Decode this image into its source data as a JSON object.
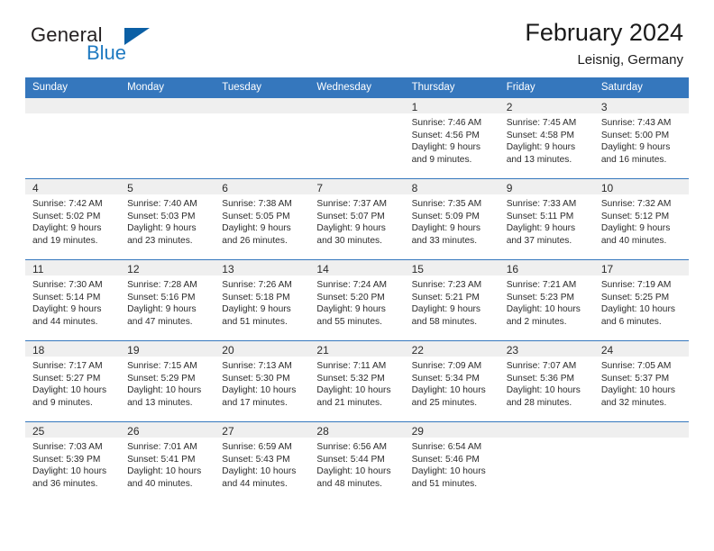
{
  "brand": {
    "name_part1": "General",
    "name_part2": "Blue",
    "triangle_icon": "triangle-icon"
  },
  "header": {
    "title": "February 2024",
    "location": "Leisnig, Germany"
  },
  "calendar": {
    "weekday_headers": [
      "Sunday",
      "Monday",
      "Tuesday",
      "Wednesday",
      "Thursday",
      "Friday",
      "Saturday"
    ],
    "accent_color": "#3577bd",
    "daynum_bg": "#efefef",
    "labels": {
      "sunrise": "Sunrise:",
      "sunset": "Sunset:",
      "daylight": "Daylight:"
    },
    "weeks": [
      [
        {
          "day": "",
          "empty": true
        },
        {
          "day": "",
          "empty": true
        },
        {
          "day": "",
          "empty": true
        },
        {
          "day": "",
          "empty": true
        },
        {
          "day": "1",
          "sunrise": "Sunrise: 7:46 AM",
          "sunset": "Sunset: 4:56 PM",
          "daylight_line1": "Daylight: 9 hours",
          "daylight_line2": "and 9 minutes."
        },
        {
          "day": "2",
          "sunrise": "Sunrise: 7:45 AM",
          "sunset": "Sunset: 4:58 PM",
          "daylight_line1": "Daylight: 9 hours",
          "daylight_line2": "and 13 minutes."
        },
        {
          "day": "3",
          "sunrise": "Sunrise: 7:43 AM",
          "sunset": "Sunset: 5:00 PM",
          "daylight_line1": "Daylight: 9 hours",
          "daylight_line2": "and 16 minutes."
        }
      ],
      [
        {
          "day": "4",
          "sunrise": "Sunrise: 7:42 AM",
          "sunset": "Sunset: 5:02 PM",
          "daylight_line1": "Daylight: 9 hours",
          "daylight_line2": "and 19 minutes."
        },
        {
          "day": "5",
          "sunrise": "Sunrise: 7:40 AM",
          "sunset": "Sunset: 5:03 PM",
          "daylight_line1": "Daylight: 9 hours",
          "daylight_line2": "and 23 minutes."
        },
        {
          "day": "6",
          "sunrise": "Sunrise: 7:38 AM",
          "sunset": "Sunset: 5:05 PM",
          "daylight_line1": "Daylight: 9 hours",
          "daylight_line2": "and 26 minutes."
        },
        {
          "day": "7",
          "sunrise": "Sunrise: 7:37 AM",
          "sunset": "Sunset: 5:07 PM",
          "daylight_line1": "Daylight: 9 hours",
          "daylight_line2": "and 30 minutes."
        },
        {
          "day": "8",
          "sunrise": "Sunrise: 7:35 AM",
          "sunset": "Sunset: 5:09 PM",
          "daylight_line1": "Daylight: 9 hours",
          "daylight_line2": "and 33 minutes."
        },
        {
          "day": "9",
          "sunrise": "Sunrise: 7:33 AM",
          "sunset": "Sunset: 5:11 PM",
          "daylight_line1": "Daylight: 9 hours",
          "daylight_line2": "and 37 minutes."
        },
        {
          "day": "10",
          "sunrise": "Sunrise: 7:32 AM",
          "sunset": "Sunset: 5:12 PM",
          "daylight_line1": "Daylight: 9 hours",
          "daylight_line2": "and 40 minutes."
        }
      ],
      [
        {
          "day": "11",
          "sunrise": "Sunrise: 7:30 AM",
          "sunset": "Sunset: 5:14 PM",
          "daylight_line1": "Daylight: 9 hours",
          "daylight_line2": "and 44 minutes."
        },
        {
          "day": "12",
          "sunrise": "Sunrise: 7:28 AM",
          "sunset": "Sunset: 5:16 PM",
          "daylight_line1": "Daylight: 9 hours",
          "daylight_line2": "and 47 minutes."
        },
        {
          "day": "13",
          "sunrise": "Sunrise: 7:26 AM",
          "sunset": "Sunset: 5:18 PM",
          "daylight_line1": "Daylight: 9 hours",
          "daylight_line2": "and 51 minutes."
        },
        {
          "day": "14",
          "sunrise": "Sunrise: 7:24 AM",
          "sunset": "Sunset: 5:20 PM",
          "daylight_line1": "Daylight: 9 hours",
          "daylight_line2": "and 55 minutes."
        },
        {
          "day": "15",
          "sunrise": "Sunrise: 7:23 AM",
          "sunset": "Sunset: 5:21 PM",
          "daylight_line1": "Daylight: 9 hours",
          "daylight_line2": "and 58 minutes."
        },
        {
          "day": "16",
          "sunrise": "Sunrise: 7:21 AM",
          "sunset": "Sunset: 5:23 PM",
          "daylight_line1": "Daylight: 10 hours",
          "daylight_line2": "and 2 minutes."
        },
        {
          "day": "17",
          "sunrise": "Sunrise: 7:19 AM",
          "sunset": "Sunset: 5:25 PM",
          "daylight_line1": "Daylight: 10 hours",
          "daylight_line2": "and 6 minutes."
        }
      ],
      [
        {
          "day": "18",
          "sunrise": "Sunrise: 7:17 AM",
          "sunset": "Sunset: 5:27 PM",
          "daylight_line1": "Daylight: 10 hours",
          "daylight_line2": "and 9 minutes."
        },
        {
          "day": "19",
          "sunrise": "Sunrise: 7:15 AM",
          "sunset": "Sunset: 5:29 PM",
          "daylight_line1": "Daylight: 10 hours",
          "daylight_line2": "and 13 minutes."
        },
        {
          "day": "20",
          "sunrise": "Sunrise: 7:13 AM",
          "sunset": "Sunset: 5:30 PM",
          "daylight_line1": "Daylight: 10 hours",
          "daylight_line2": "and 17 minutes."
        },
        {
          "day": "21",
          "sunrise": "Sunrise: 7:11 AM",
          "sunset": "Sunset: 5:32 PM",
          "daylight_line1": "Daylight: 10 hours",
          "daylight_line2": "and 21 minutes."
        },
        {
          "day": "22",
          "sunrise": "Sunrise: 7:09 AM",
          "sunset": "Sunset: 5:34 PM",
          "daylight_line1": "Daylight: 10 hours",
          "daylight_line2": "and 25 minutes."
        },
        {
          "day": "23",
          "sunrise": "Sunrise: 7:07 AM",
          "sunset": "Sunset: 5:36 PM",
          "daylight_line1": "Daylight: 10 hours",
          "daylight_line2": "and 28 minutes."
        },
        {
          "day": "24",
          "sunrise": "Sunrise: 7:05 AM",
          "sunset": "Sunset: 5:37 PM",
          "daylight_line1": "Daylight: 10 hours",
          "daylight_line2": "and 32 minutes."
        }
      ],
      [
        {
          "day": "25",
          "sunrise": "Sunrise: 7:03 AM",
          "sunset": "Sunset: 5:39 PM",
          "daylight_line1": "Daylight: 10 hours",
          "daylight_line2": "and 36 minutes."
        },
        {
          "day": "26",
          "sunrise": "Sunrise: 7:01 AM",
          "sunset": "Sunset: 5:41 PM",
          "daylight_line1": "Daylight: 10 hours",
          "daylight_line2": "and 40 minutes."
        },
        {
          "day": "27",
          "sunrise": "Sunrise: 6:59 AM",
          "sunset": "Sunset: 5:43 PM",
          "daylight_line1": "Daylight: 10 hours",
          "daylight_line2": "and 44 minutes."
        },
        {
          "day": "28",
          "sunrise": "Sunrise: 6:56 AM",
          "sunset": "Sunset: 5:44 PM",
          "daylight_line1": "Daylight: 10 hours",
          "daylight_line2": "and 48 minutes."
        },
        {
          "day": "29",
          "sunrise": "Sunrise: 6:54 AM",
          "sunset": "Sunset: 5:46 PM",
          "daylight_line1": "Daylight: 10 hours",
          "daylight_line2": "and 51 minutes."
        },
        {
          "day": "",
          "empty": true
        },
        {
          "day": "",
          "empty": true
        }
      ]
    ]
  }
}
